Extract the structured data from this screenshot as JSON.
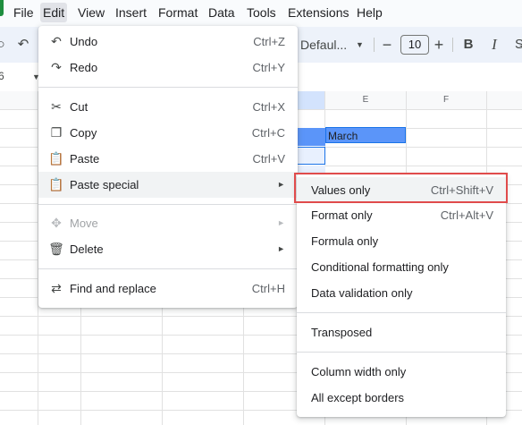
{
  "menubar": {
    "items": [
      "File",
      "Edit",
      "View",
      "Insert",
      "Format",
      "Data",
      "Tools",
      "Extensions",
      "Help"
    ],
    "active": "Edit"
  },
  "toolbar": {
    "font_name": "Defaul...",
    "font_size": "10",
    "bold": "B",
    "italic": "I"
  },
  "namebox": {
    "value": "6"
  },
  "columns": {
    "e": "E",
    "f": "F"
  },
  "cell_march": "March",
  "edit_menu": {
    "undo": {
      "label": "Undo",
      "shortcut": "Ctrl+Z"
    },
    "redo": {
      "label": "Redo",
      "shortcut": "Ctrl+Y"
    },
    "cut": {
      "label": "Cut",
      "shortcut": "Ctrl+X"
    },
    "copy": {
      "label": "Copy",
      "shortcut": "Ctrl+C"
    },
    "paste": {
      "label": "Paste",
      "shortcut": "Ctrl+V"
    },
    "paste_special": {
      "label": "Paste special"
    },
    "move": {
      "label": "Move"
    },
    "delete": {
      "label": "Delete"
    },
    "find_replace": {
      "label": "Find and replace",
      "shortcut": "Ctrl+H"
    }
  },
  "paste_special_menu": {
    "values_only": {
      "label": "Values only",
      "shortcut": "Ctrl+Shift+V"
    },
    "format_only": {
      "label": "Format only",
      "shortcut": "Ctrl+Alt+V"
    },
    "formula_only": {
      "label": "Formula only"
    },
    "conditional_formatting_only": {
      "label": "Conditional formatting only"
    },
    "data_validation_only": {
      "label": "Data validation only"
    },
    "transposed": {
      "label": "Transposed"
    },
    "column_width_only": {
      "label": "Column width only"
    },
    "all_except_borders": {
      "label": "All except borders"
    }
  },
  "colors": {
    "highlight_border": "#e04b4b",
    "selected_cell": "#5b95f9",
    "toolbar_bg": "#edf2fa"
  }
}
